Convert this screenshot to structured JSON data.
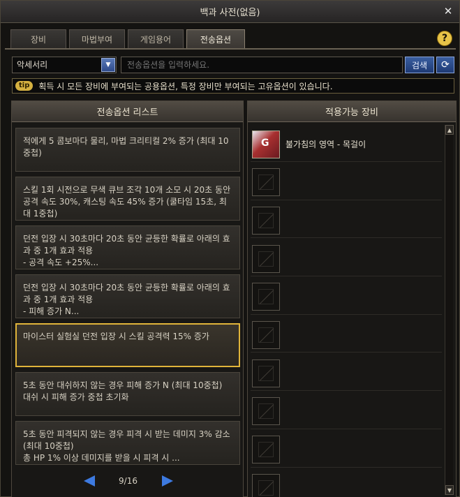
{
  "window": {
    "title": "백과 사전(없음)"
  },
  "tabs": [
    {
      "label": "장비"
    },
    {
      "label": "마법부여"
    },
    {
      "label": "게임용어"
    },
    {
      "label": "전송옵션"
    }
  ],
  "search": {
    "category": "악세서리",
    "placeholder": "전송옵션을 입력하세요.",
    "search_label": "검색"
  },
  "tip": {
    "badge": "tip",
    "text": "획득 시 모든 장비에 부여되는 공용옵션, 특정 장비만 부여되는 고유옵션이 있습니다."
  },
  "left_panel": {
    "header": "전송옵션 리스트",
    "options": [
      {
        "text": "적에게 5 콤보마다 물리, 마법 크리티컬 2% 증가 (최대 10중첩)"
      },
      {
        "text": "스킬 1회 시전으로 무색 큐브 조각 10개 소모 시 20초 동안 공격 속도 30%, 캐스팅 속도 45% 증가 (쿨타임 15초, 최대 1중첩)"
      },
      {
        "text": "던전 입장 시 30초마다 20초 동안 균등한 확률로 아래의 효과 중 1개 효과 적용\n- 공격 속도 +25%..."
      },
      {
        "text": "던전 입장 시 30초마다 20초 동안 균등한 확률로 아래의 효과 중 1개 효과 적용\n- 피해 증가 N..."
      },
      {
        "text": "마이스터 실험실 던전 입장 시 스킬 공격력 15% 증가"
      },
      {
        "text": "5초 동안 대쉬하지 않는 경우 피해 증가 N (최대 10중첩)\n대쉬 시 피해 증가 중첩 초기화"
      },
      {
        "text": "5초 동안 피격되지 않는 경우 피격 시 받는 데미지 3% 감소 (최대 10중첩)\n총 HP 1% 이상 데미지를 받을 시 피격 시 ..."
      }
    ],
    "pager": "9/16"
  },
  "right_panel": {
    "header": "적용가능 장비",
    "items": [
      {
        "name": "불가침의 영역 - 목걸이",
        "icon": "necklace-icon"
      }
    ]
  }
}
